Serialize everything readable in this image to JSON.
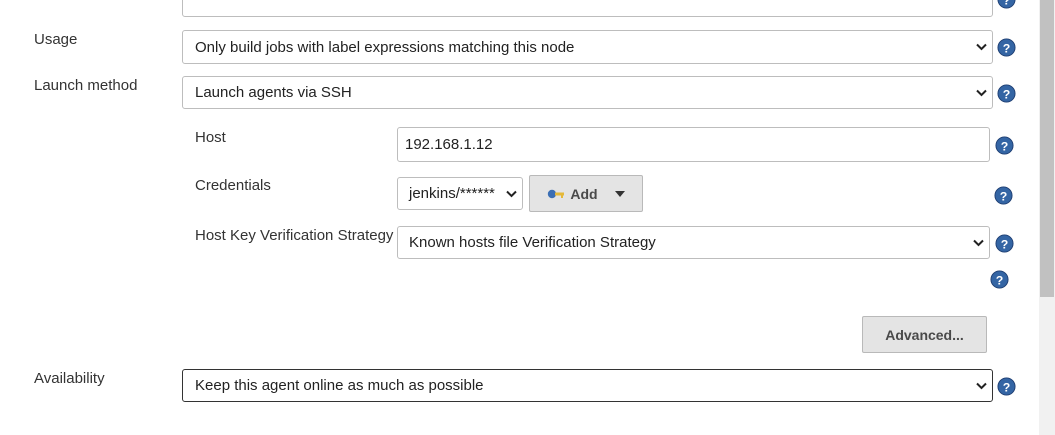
{
  "form": {
    "top_field_value": "",
    "usage": {
      "label": "Usage",
      "selected": "Only build jobs with label expressions matching this node"
    },
    "launch_method": {
      "label": "Launch method",
      "selected": "Launch agents via SSH"
    },
    "host": {
      "label": "Host",
      "value": "192.168.1.12"
    },
    "credentials": {
      "label": "Credentials",
      "selected": "jenkins/******",
      "add_label": "Add"
    },
    "host_key": {
      "label": "Host Key Verification Strategy",
      "selected": "Known hosts file Verification Strategy"
    },
    "advanced_label": "Advanced...",
    "availability": {
      "label": "Availability",
      "selected": "Keep this agent online as much as possible"
    }
  },
  "icons": {
    "help": "help-icon",
    "chevron": "chevron-down-icon",
    "key": "key-icon",
    "caret": "caret-down-icon"
  },
  "colors": {
    "help_icon": "#3465a4",
    "button_bg": "#e4e4e4"
  }
}
